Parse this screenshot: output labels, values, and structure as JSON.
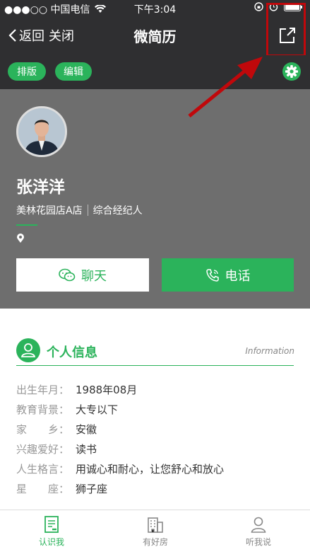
{
  "status": {
    "carrier": "●●●○○ 中国电信",
    "time": "下午3:04"
  },
  "nav": {
    "back": "返回",
    "close": "关闭",
    "title": "微简历"
  },
  "toolbar": {
    "layout": "排版",
    "edit": "编辑"
  },
  "profile": {
    "name": "张洋洋",
    "store": "美林花园店A店",
    "role": "综合经纪人"
  },
  "actions": {
    "chat": "聊天",
    "call": "电话"
  },
  "section": {
    "title": "个人信息",
    "subtitle": "Information"
  },
  "info": [
    {
      "label": "出生年月：",
      "value": "1988年08月"
    },
    {
      "label": "教育背景：",
      "value": "大专以下"
    },
    {
      "label": "家　　乡：",
      "value": "安徽"
    },
    {
      "label": "兴趣爱好：",
      "value": "读书"
    },
    {
      "label": "人生格言：",
      "value": "用诚心和耐心，让您舒心和放心"
    },
    {
      "label": "星　　座：",
      "value": "狮子座"
    }
  ],
  "tabs": [
    {
      "label": "认识我",
      "color": "#2bb35b"
    },
    {
      "label": "有好房",
      "color": "#888888"
    },
    {
      "label": "听我说",
      "color": "#888888"
    }
  ],
  "colors": {
    "accent": "#2bb35b",
    "annotation": "#c0080b"
  }
}
